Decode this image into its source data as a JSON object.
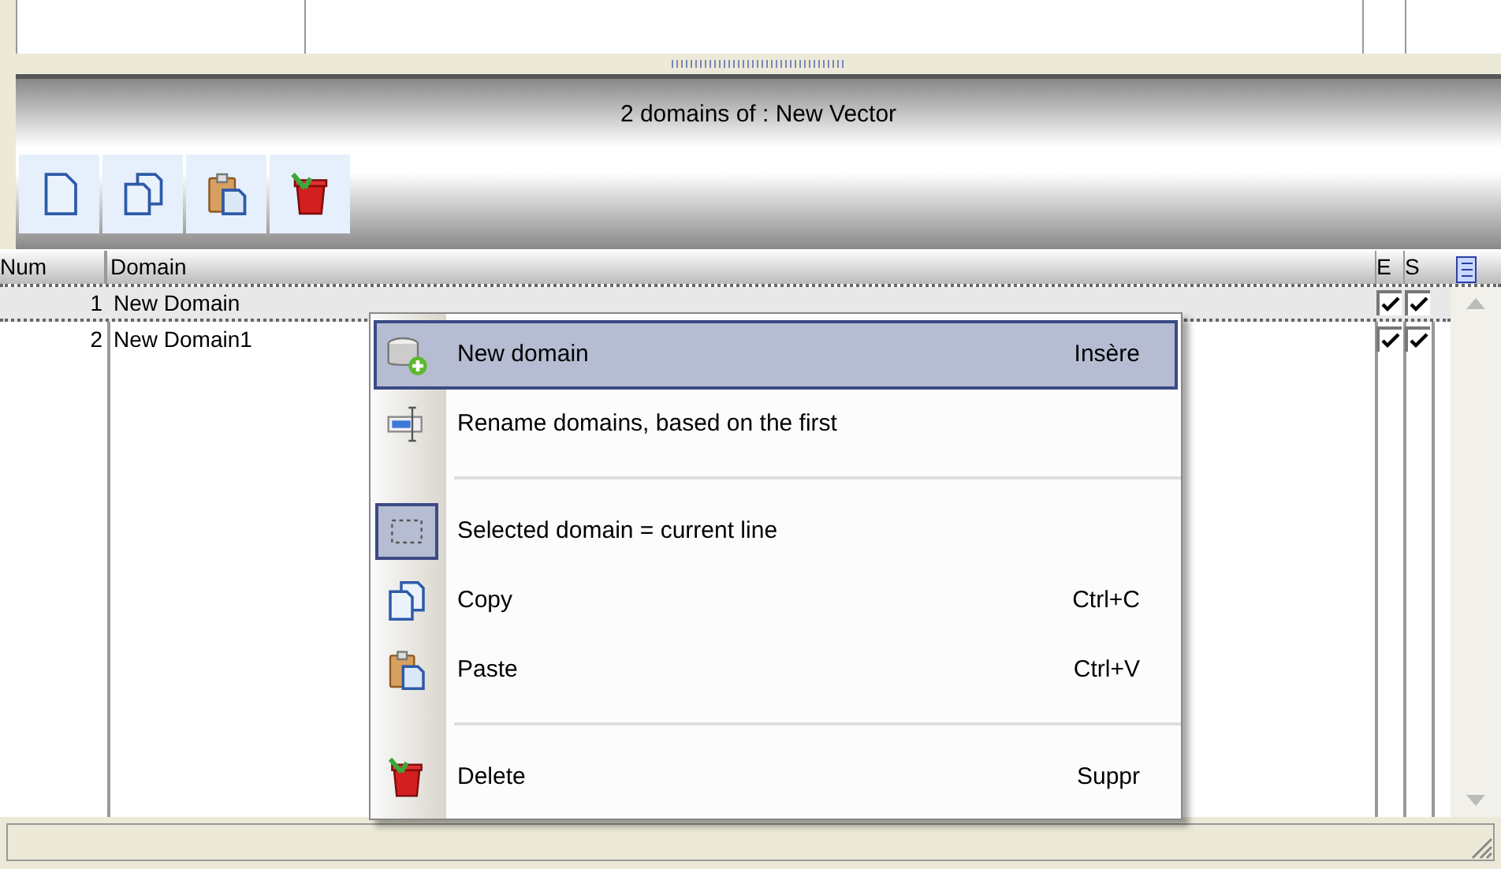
{
  "panel": {
    "title": "2 domains of : New Vector"
  },
  "toolbar": [
    {
      "kind": "new"
    },
    {
      "kind": "copy"
    },
    {
      "kind": "paste"
    },
    {
      "kind": "delete"
    }
  ],
  "table": {
    "columns": [
      "Num",
      "Domain",
      "E",
      "S"
    ],
    "rows": [
      {
        "num": "1",
        "domain": "New Domain",
        "e": true,
        "s": true,
        "selected": true
      },
      {
        "num": "2",
        "domain": "New Domain1",
        "e": true,
        "s": true,
        "selected": false
      }
    ]
  },
  "context_menu": [
    {
      "kind": "item",
      "label": "New domain",
      "shortcut": "Insère",
      "selected": true,
      "checked": false
    },
    {
      "kind": "item",
      "label": "Rename domains, based on the first",
      "selected": false,
      "checked": false
    },
    {
      "kind": "separator"
    },
    {
      "kind": "item",
      "label": "Selected domain = current line",
      "selected": false,
      "checked": true
    },
    {
      "kind": "item",
      "label": "Copy",
      "shortcut": "Ctrl+C",
      "selected": false,
      "checked": false
    },
    {
      "kind": "item",
      "label": "Paste",
      "shortcut": "Ctrl+V",
      "selected": false,
      "checked": false
    },
    {
      "kind": "separator"
    },
    {
      "kind": "item",
      "label": "Delete",
      "shortcut": "Suppr",
      "selected": false,
      "checked": false
    }
  ]
}
